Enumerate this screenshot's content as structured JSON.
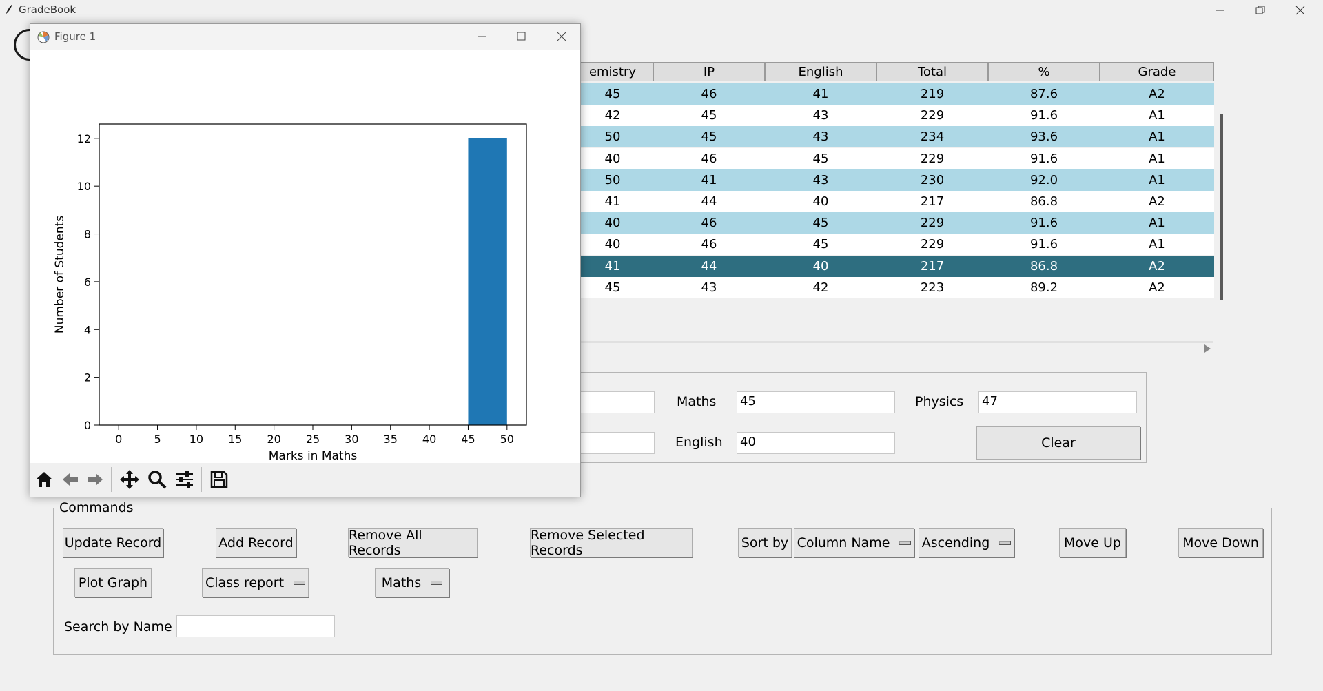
{
  "app": {
    "title": "GradeBook"
  },
  "table": {
    "columns": [
      "emistry",
      "IP",
      "English",
      "Total",
      "%",
      "Grade"
    ],
    "rows": [
      [
        "45",
        "46",
        "41",
        "219",
        "87.6",
        "A2"
      ],
      [
        "42",
        "45",
        "43",
        "229",
        "91.6",
        "A1"
      ],
      [
        "50",
        "45",
        "43",
        "234",
        "93.6",
        "A1"
      ],
      [
        "40",
        "46",
        "45",
        "229",
        "91.6",
        "A1"
      ],
      [
        "50",
        "41",
        "43",
        "230",
        "92.0",
        "A1"
      ],
      [
        "41",
        "44",
        "40",
        "217",
        "86.8",
        "A2"
      ],
      [
        "40",
        "46",
        "45",
        "229",
        "91.6",
        "A1"
      ],
      [
        "40",
        "46",
        "45",
        "229",
        "91.6",
        "A1"
      ],
      [
        "41",
        "44",
        "40",
        "217",
        "86.8",
        "A2"
      ],
      [
        "45",
        "43",
        "42",
        "223",
        "89.2",
        "A2"
      ]
    ],
    "selected_row": 8,
    "colors": {
      "stripe": "#add8e6",
      "selected": "#2e6e80",
      "selected_text": "#ffffff"
    }
  },
  "form": {
    "maths_label": "Maths",
    "maths_value": "45",
    "physics_label": "Physics",
    "physics_value": "47",
    "english_label": "English",
    "english_value": "40",
    "clear_label": "Clear"
  },
  "commands": {
    "title": "Commands",
    "update_record": "Update Record",
    "add_record": "Add Record",
    "remove_all": "Remove All Records",
    "remove_selected": "Remove Selected Records",
    "sort_by": "Sort by",
    "column_name": "Column Name",
    "ascending": "Ascending",
    "move_up": "Move Up",
    "move_down": "Move Down",
    "plot_graph": "Plot Graph",
    "class_report": "Class report",
    "subject": "Maths",
    "search_label": "Search by Name",
    "search_value": ""
  },
  "figure": {
    "title": "Figure 1",
    "toolbar": [
      "home-icon",
      "back-icon",
      "forward-icon",
      "pan-icon",
      "zoom-icon",
      "configure-icon",
      "save-icon"
    ]
  },
  "chart_data": {
    "type": "bar",
    "xlabel": "Marks in Maths",
    "ylabel": "Number of Students",
    "xlim": [
      -2.5,
      52.5
    ],
    "ylim": [
      0,
      12.6
    ],
    "xticks": [
      0,
      5,
      10,
      15,
      20,
      25,
      30,
      35,
      40,
      45,
      50
    ],
    "yticks": [
      0,
      2,
      4,
      6,
      8,
      10,
      12
    ],
    "bins": [
      {
        "from": 45,
        "to": 50,
        "count": 12
      }
    ],
    "bar_color": "#1f77b4"
  }
}
